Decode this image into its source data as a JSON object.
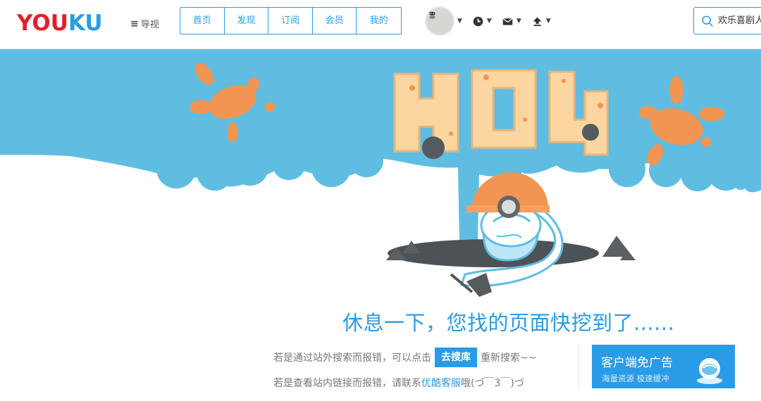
{
  "header": {
    "logo": [
      "YOU",
      "KU"
    ],
    "guide_label": "导视",
    "nav": [
      "首页",
      "发现",
      "订阅",
      "会员",
      "我的"
    ],
    "search_placeholder": "欢乐喜剧人"
  },
  "main": {
    "headline": "休息一下，您找的页面快挖到了......",
    "line1_prefix": "若是通过站外搜索而报错，可以点击",
    "line1_button": "去搜库",
    "line1_suffix": "重新搜索~~",
    "line2_prefix": "若是查看站内链接而报错，请联系",
    "line2_link": "优酷客服",
    "line2_suffix": "哦(づ￣3￣)づ"
  },
  "client_promo": {
    "title": "客户端免广告",
    "subtitle": "海量资源 极速缓冲"
  },
  "colors": {
    "brand_red": "#e41f2b",
    "brand_blue": "#2a9be6",
    "sky": "#5fbde2",
    "splat": "#f29552"
  }
}
